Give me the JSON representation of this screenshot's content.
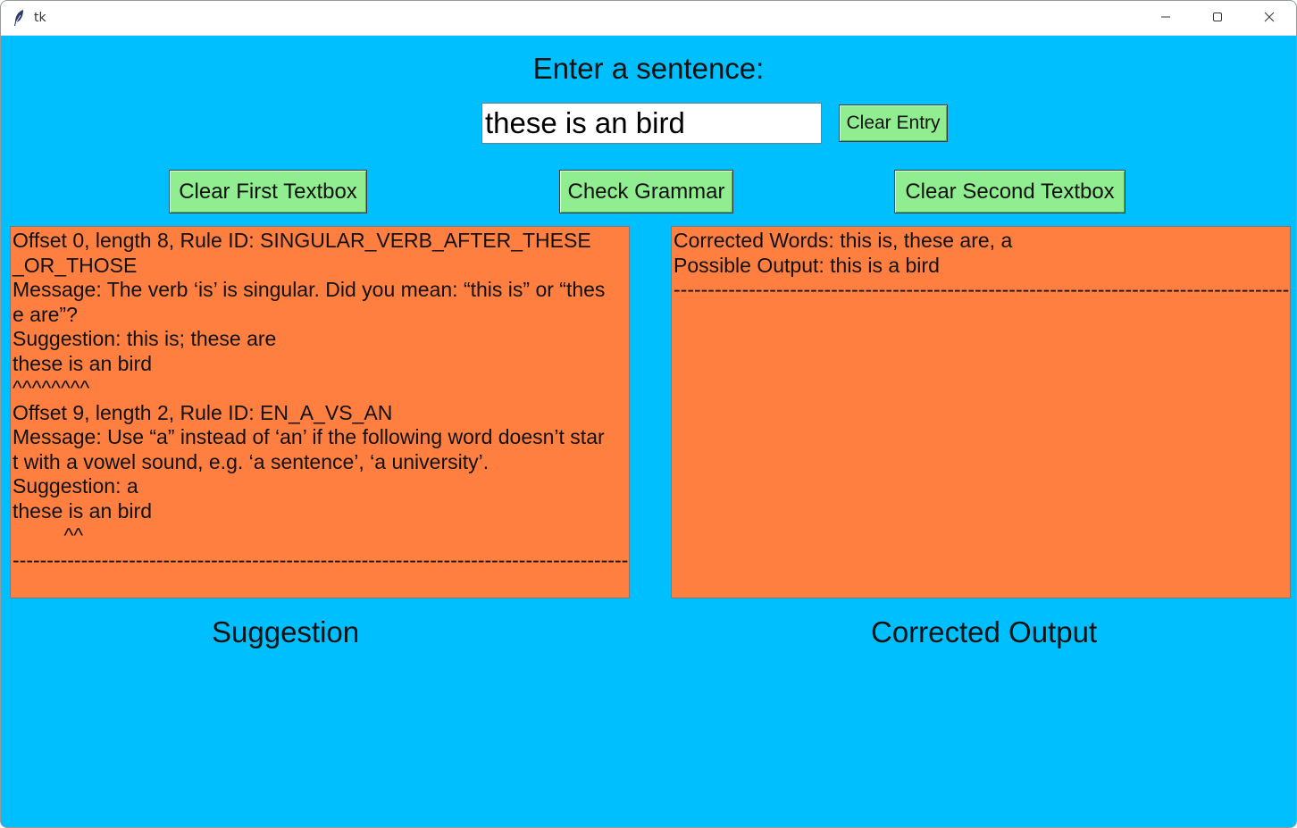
{
  "window": {
    "title": "tk",
    "icons": [
      "feather-icon",
      "minimize-icon",
      "maximize-icon",
      "close-icon"
    ]
  },
  "prompt": {
    "label": "Enter a sentence:"
  },
  "entry": {
    "value": "these is an bird"
  },
  "buttons": {
    "clear_entry": "Clear Entry",
    "clear_first": "Clear First Textbox",
    "check_grammar": "Check Grammar",
    "clear_second": "Clear Second Textbox"
  },
  "suggestion_box": {
    "lines": [
      "Offset 0, length 8, Rule ID: SINGULAR_VERB_AFTER_THESE",
      "_OR_THOSE",
      "Message: The verb ‘is’ is singular. Did you mean: “this is” or “thes",
      "e are”?",
      "Suggestion: this is; these are",
      "these is an bird",
      "^^^^^^^^",
      "Offset 9, length 2, Rule ID: EN_A_VS_AN",
      "Message: Use “a” instead of ‘an’ if the following word doesn’t star",
      "t with a vowel sound, e.g. ‘a sentence’, ‘a university’.",
      "Suggestion: a",
      "these is an bird",
      "         ^^",
      "----------------------------------------------------------------------------------------------"
    ]
  },
  "output_box": {
    "lines": [
      "Corrected Words: this is, these are, a",
      "Possible Output: this is a bird",
      "----------------------------------------------------------------------------------------------"
    ]
  },
  "captions": {
    "suggestion": "Suggestion",
    "corrected": "Corrected Output"
  },
  "colors": {
    "background": "#00bfff",
    "button": "#90ee90",
    "textbox": "#ff7f40",
    "entry": "#ffffff"
  }
}
